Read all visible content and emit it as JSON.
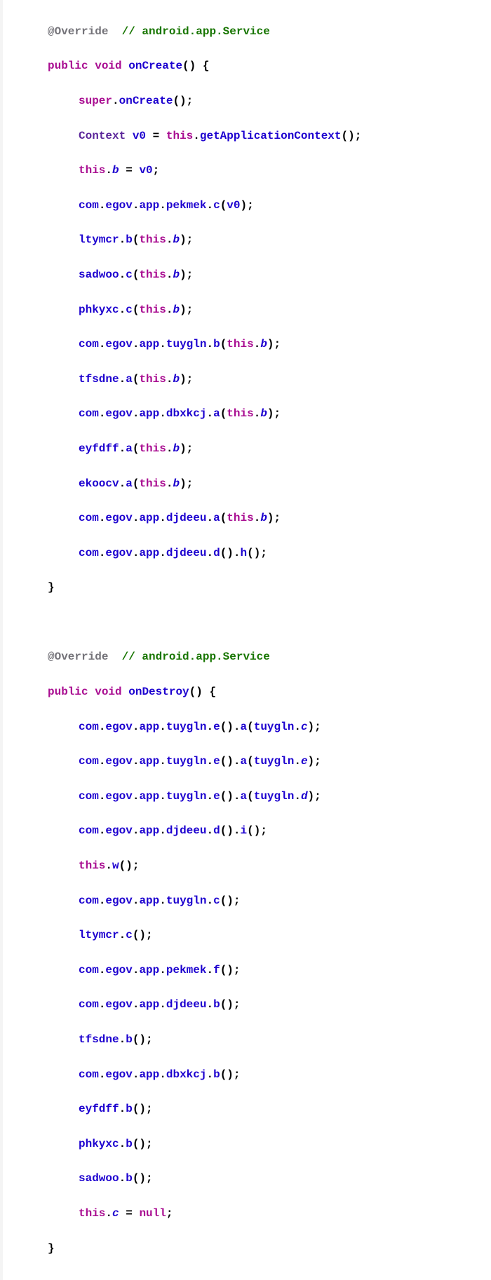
{
  "tokens": {
    "override": "@Override",
    "svc_comment": "// android.app.Service",
    "public": "public",
    "void": "void",
    "super": "super",
    "this": "this",
    "null": "null",
    "onCreate": "onCreate",
    "onDestroy": "onDestroy",
    "Context": "Context",
    "v0": "v0",
    "getApplicationContext": "getApplicationContext",
    "b": "b",
    "c": "c",
    "a": "a",
    "e": "e",
    "d": "d",
    "f": "f",
    "h": "h",
    "i": "i",
    "w": "w",
    "com": "com",
    "egov": "egov",
    "app": "app",
    "pekmek": "pekmek",
    "ltymcr": "ltymcr",
    "sadwoo": "sadwoo",
    "phkyxc": "phkyxc",
    "tuygln": "tuygln",
    "tfsdne": "tfsdne",
    "dbxkcj": "dbxkcj",
    "eyfdff": "eyfdff",
    "ekoocv": "ekoocv",
    "djdeeu": "djdeeu"
  }
}
